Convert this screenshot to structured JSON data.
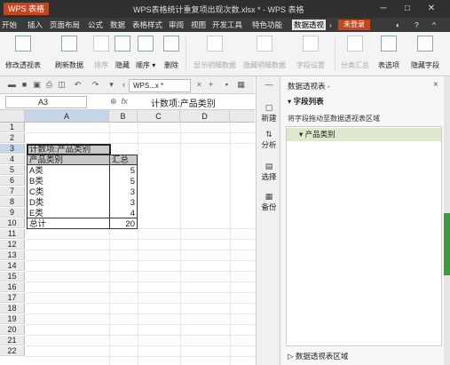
{
  "title_bar": {
    "app_label": "WPS 表格",
    "doc_title": "WPS表格统计重复项出现次数.xlsx * - WPS 表格",
    "menu_glyph": "≡"
  },
  "menu_bar": {
    "items": [
      "开始",
      "插入",
      "页面布局",
      "公式",
      "数据",
      "表格样式",
      "审阅",
      "视图",
      "开发工具",
      "特色功能",
      "数据透视"
    ],
    "active_index": 10,
    "login_label": "未登录"
  },
  "ribbon": {
    "buttons": [
      {
        "label": "修改透视表",
        "enabled": true
      },
      {
        "label": "刷新数据",
        "enabled": true
      },
      {
        "label": "排序",
        "enabled": false
      },
      {
        "label": "隐藏",
        "enabled": true
      },
      {
        "label": "顺序 ▾",
        "enabled": true
      },
      {
        "label": "删除",
        "enabled": true
      },
      {
        "label": "显示明细数据",
        "enabled": false
      },
      {
        "label": "隐藏明细数据",
        "enabled": false
      },
      {
        "label": "字段设置",
        "enabled": false
      },
      {
        "label": "分类汇总",
        "enabled": false
      },
      {
        "label": "表选项",
        "enabled": true
      },
      {
        "label": "隐藏字段",
        "enabled": true
      }
    ]
  },
  "doc_tab": {
    "label": "WPS...x *"
  },
  "formula_bar": {
    "name_box": "A3",
    "fx_label": "fx",
    "formula": "计数项:产品类别"
  },
  "sheet": {
    "columns": [
      "A",
      "B",
      "C",
      "D"
    ],
    "rows": [
      "1",
      "2",
      "3",
      "4",
      "5",
      "6",
      "7",
      "8",
      "9",
      "10",
      "11",
      "12",
      "13",
      "14",
      "15",
      "16",
      "17",
      "18",
      "19",
      "20",
      "21",
      "22"
    ],
    "pivot": {
      "header": "计数项:产品类别",
      "col_label": "产品类别",
      "col_total": "汇总",
      "items": [
        {
          "label": "A类",
          "value": "5"
        },
        {
          "label": "B类",
          "value": "5"
        },
        {
          "label": "C类",
          "value": "3"
        },
        {
          "label": "D类",
          "value": "3"
        },
        {
          "label": "E类",
          "value": "4"
        }
      ],
      "total_label": "总计",
      "total_value": "20"
    }
  },
  "side_toolbar": {
    "items": [
      {
        "label": "新建"
      },
      {
        "label": "分析"
      },
      {
        "label": "选择"
      },
      {
        "label": "备份"
      }
    ]
  },
  "pivot_panel": {
    "title": "数据透视表 -",
    "section": "字段列表",
    "hint": "将字段拖动至数据透视表区域",
    "fields": [
      "产品类别"
    ],
    "footer": "数据透视表区域"
  }
}
